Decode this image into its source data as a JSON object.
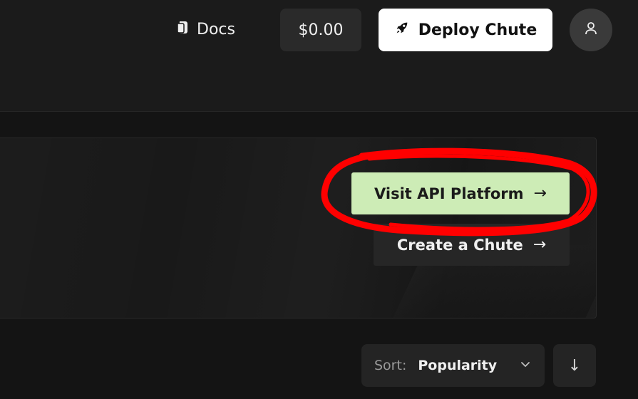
{
  "header": {
    "docs_label": "Docs",
    "balance": "$0.00",
    "deploy_label": "Deploy Chute"
  },
  "hero": {
    "api_platform_label": "Visit API Platform",
    "create_chute_label": "Create a Chute",
    "arrow": "→"
  },
  "sort": {
    "label": "Sort:",
    "value": "Popularity",
    "direction_symbol": "↓"
  },
  "colors": {
    "background": "#141414",
    "header": "#1b1b1b",
    "accent_green": "#cdecb6",
    "annotation_red": "#ff0000"
  },
  "icons": {
    "docs": "docs-icon",
    "deploy": "rocket-icon",
    "avatar": "user-icon",
    "sort": "chevron-down-icon"
  }
}
